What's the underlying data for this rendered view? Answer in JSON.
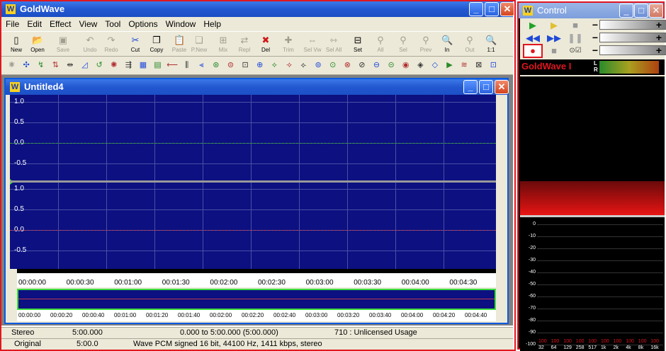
{
  "main_window": {
    "title": "GoldWave",
    "logo": "W"
  },
  "menu": [
    "File",
    "Edit",
    "Effect",
    "View",
    "Tool",
    "Options",
    "Window",
    "Help"
  ],
  "toolbar": [
    {
      "label": "New",
      "icon": "new-file-icon",
      "enabled": true
    },
    {
      "label": "Open",
      "icon": "open-folder-icon",
      "enabled": true
    },
    {
      "label": "Save",
      "icon": "save-icon",
      "enabled": false
    },
    {
      "label": "Undo",
      "icon": "undo-icon",
      "enabled": false
    },
    {
      "label": "Redo",
      "icon": "redo-icon",
      "enabled": false
    },
    {
      "label": "Cut",
      "icon": "scissors-icon",
      "enabled": true
    },
    {
      "label": "Copy",
      "icon": "copy-icon",
      "enabled": true
    },
    {
      "label": "Paste",
      "icon": "paste-icon",
      "enabled": false
    },
    {
      "label": "P.New",
      "icon": "paste-new-icon",
      "enabled": false
    },
    {
      "label": "Mix",
      "icon": "mix-icon",
      "enabled": false
    },
    {
      "label": "Repl",
      "icon": "replace-icon",
      "enabled": false
    },
    {
      "label": "Del",
      "icon": "delete-icon",
      "enabled": true
    },
    {
      "label": "Trim",
      "icon": "trim-icon",
      "enabled": false
    },
    {
      "label": "Sel Vw",
      "icon": "select-view-icon",
      "enabled": false
    },
    {
      "label": "Sel All",
      "icon": "select-all-icon",
      "enabled": false
    },
    {
      "label": "Set",
      "icon": "set-icon",
      "enabled": true
    },
    {
      "label": "All",
      "icon": "zoom-all-icon",
      "enabled": false
    },
    {
      "label": "Sel",
      "icon": "zoom-selection-icon",
      "enabled": false
    },
    {
      "label": "Prev",
      "icon": "zoom-previous-icon",
      "enabled": false
    },
    {
      "label": "In",
      "icon": "zoom-in-icon",
      "enabled": true
    },
    {
      "label": "Out",
      "icon": "zoom-out-icon",
      "enabled": false
    },
    {
      "label": "1:1",
      "icon": "zoom-1to1-icon",
      "enabled": true
    }
  ],
  "child_window": {
    "title": "Untitled4"
  },
  "waveform": {
    "top_channel_labels": [
      "1.0",
      "0.5",
      "0.0",
      "-0.5"
    ],
    "bottom_channel_labels": [
      "1.0",
      "0.5",
      "0.0",
      "-0.5"
    ],
    "time_ticks": [
      "00:00:00",
      "00:00:30",
      "00:01:00",
      "00:01:30",
      "00:02:00",
      "00:02:30",
      "00:03:00",
      "00:03:30",
      "00:04:00",
      "00:04:30"
    ],
    "overview_ticks": [
      "00:00:00",
      "00:00:20",
      "00:00:40",
      "00:01:00",
      "00:01:20",
      "00:01:40",
      "00:02:00",
      "00:02:20",
      "00:02:40",
      "00:03:00",
      "00:03:20",
      "00:03:40",
      "00:04:00",
      "00:04:20",
      "00:04:40"
    ]
  },
  "status1": {
    "channels": "Stereo",
    "length": "5:00.000",
    "selection": "0.000 to 5:00.000 (5:00.000)",
    "license": "710 : Unlicensed Usage"
  },
  "status2": {
    "mode": "Original",
    "length": "5:00.0",
    "format": "Wave PCM signed 16 bit, 44100 Hz, 1411 kbps, stereo"
  },
  "control": {
    "title": "Control",
    "brand": "GoldWave I",
    "vu_labels": [
      "L",
      "R"
    ],
    "db_labels": [
      "0",
      "-10",
      "-20",
      "-30",
      "-40",
      "-50",
      "-60",
      "-70",
      "-80",
      "-90",
      "-100"
    ],
    "freq_labels": [
      "32",
      "64",
      "129",
      "258",
      "517",
      "1k",
      "2k",
      "4k",
      "8k",
      "16k"
    ],
    "peak_values": [
      "100",
      "100",
      "100",
      "100",
      "100",
      "100",
      "100",
      "100",
      "100",
      "100"
    ]
  },
  "colors": {
    "wave_bg": "#0c1080",
    "title_blue": "#2358d0",
    "accent_red": "#e0161f"
  }
}
